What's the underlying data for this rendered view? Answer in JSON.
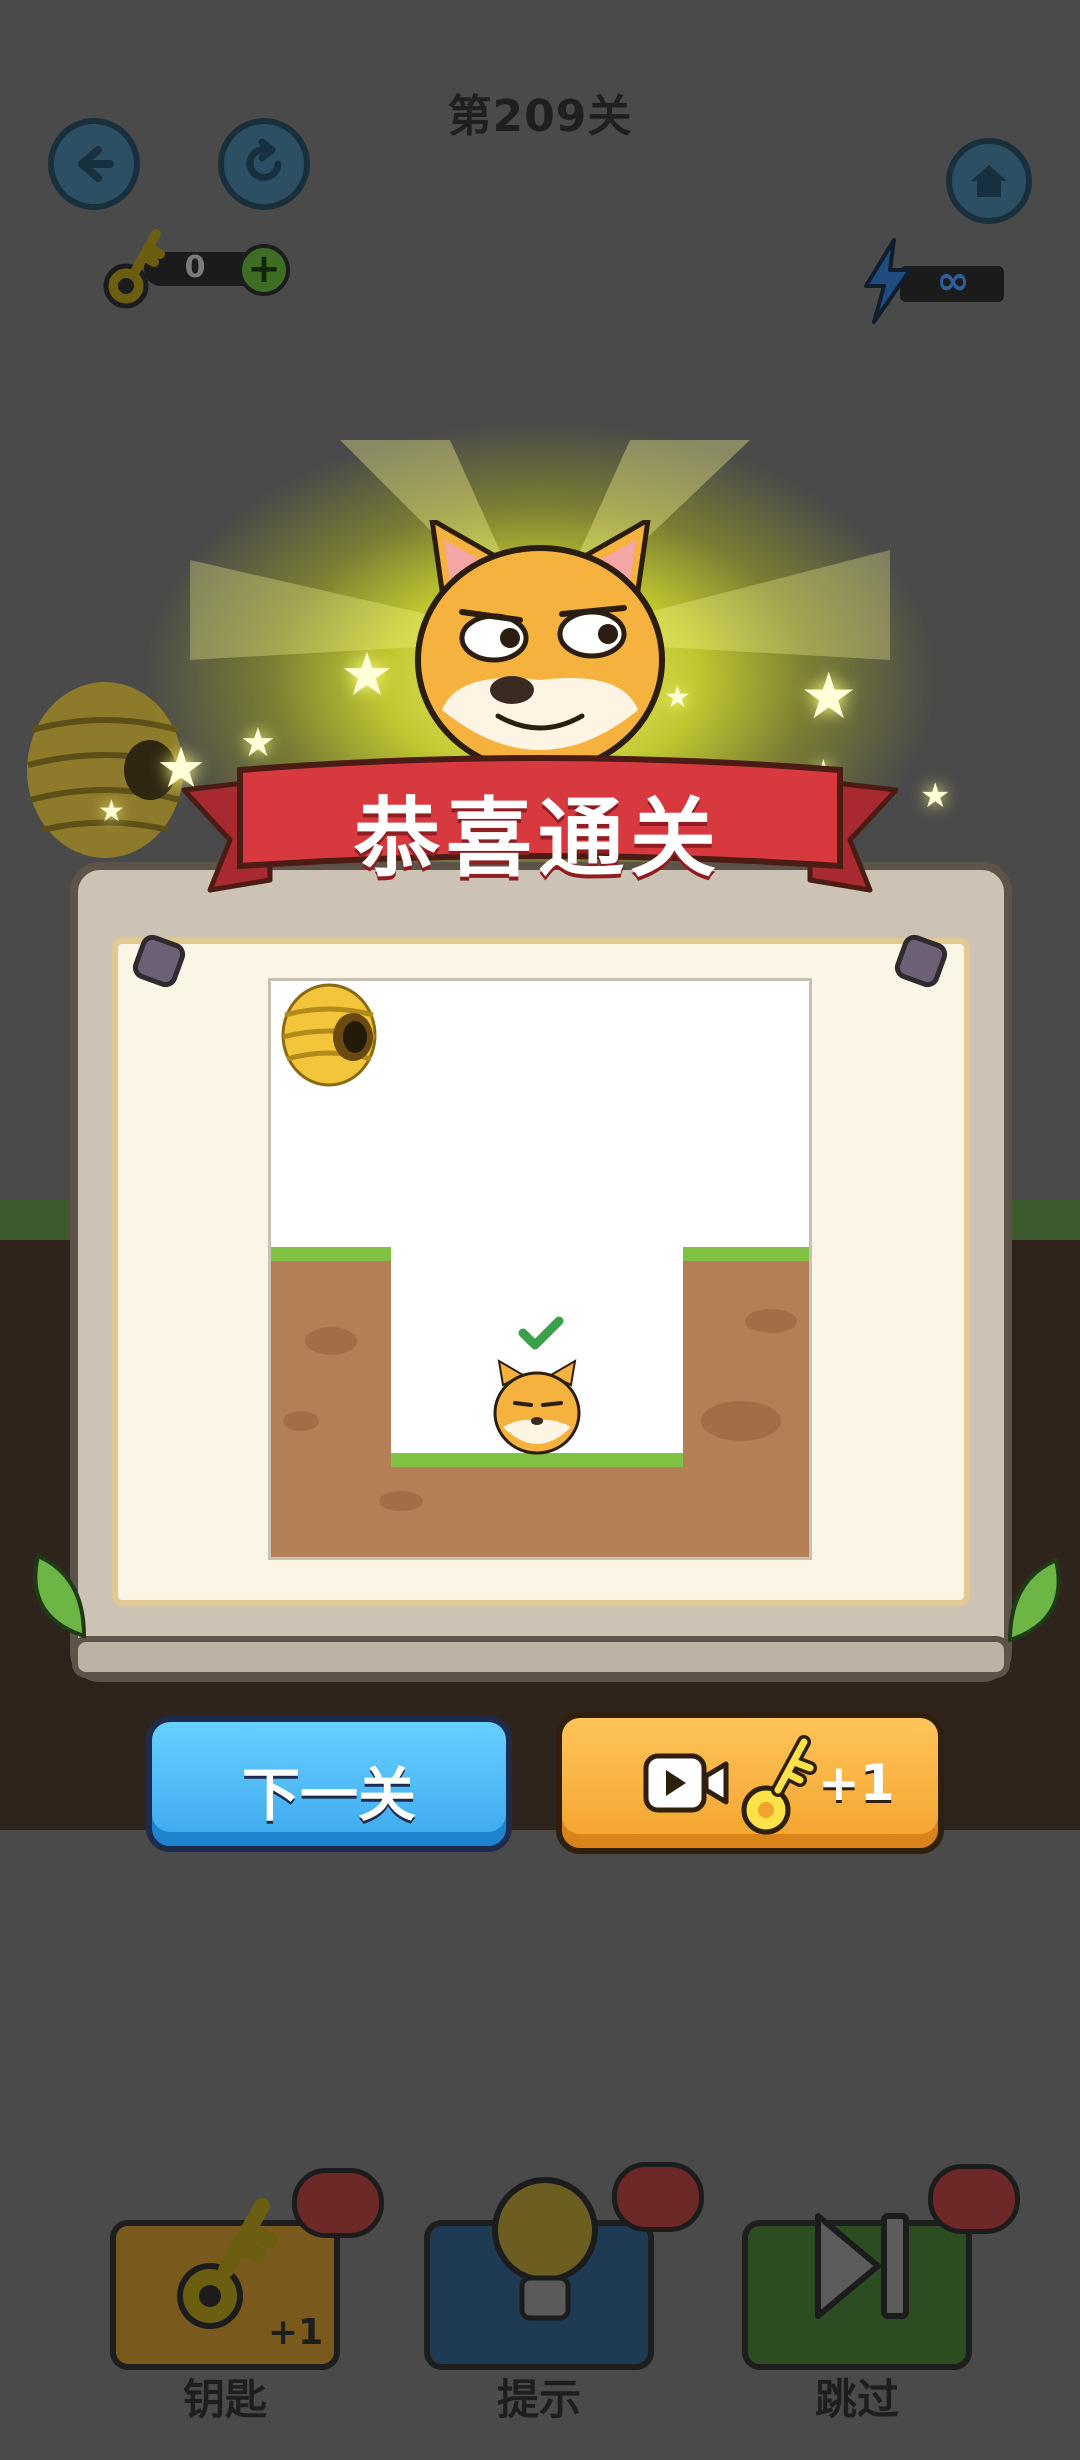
{
  "header": {
    "level_title": "第209关",
    "keys": {
      "count": "0",
      "plus": "+"
    },
    "energy": {
      "value": "∞"
    }
  },
  "dialog": {
    "banner_title": "恭喜通关",
    "next_button_label": "下一关",
    "watch_ad_reward": "+1"
  },
  "toolbar": {
    "items": [
      {
        "label": "钥匙",
        "plus": "+1",
        "icon": "key-icon"
      },
      {
        "label": "提示",
        "icon": "lightbulb-icon"
      },
      {
        "label": "跳过",
        "icon": "skip-icon"
      }
    ]
  },
  "colors": {
    "next_button": "#3ba8ee",
    "watch_button": "#f3a32c",
    "ribbon": "#d8393f",
    "dirt": "#b27f57",
    "grass": "#7fc243"
  }
}
